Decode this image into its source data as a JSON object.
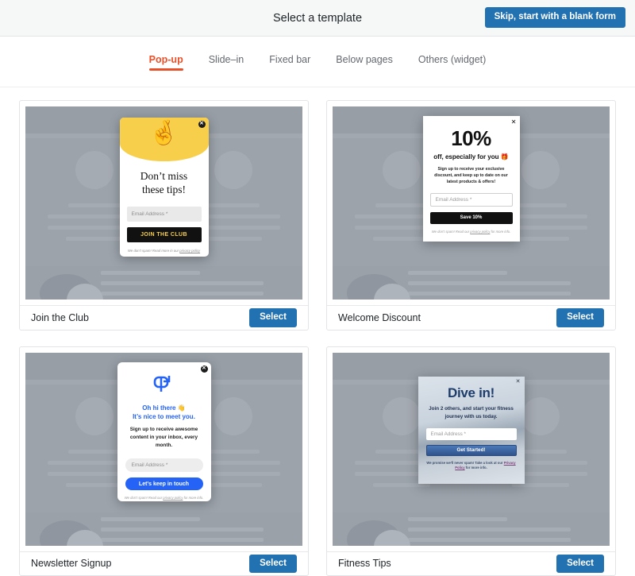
{
  "header": {
    "title": "Select a template",
    "skip_button": "Skip, start with a blank form"
  },
  "tabs": [
    {
      "label": "Pop-up",
      "active": true
    },
    {
      "label": "Slide–in",
      "active": false
    },
    {
      "label": "Fixed bar",
      "active": false
    },
    {
      "label": "Below pages",
      "active": false
    },
    {
      "label": "Others (widget)",
      "active": false
    }
  ],
  "colors": {
    "accent_tab": "#e8502a",
    "primary_button": "#2271b1",
    "template1_yellow": "#f7cf4b",
    "template3_blue": "#2563f6",
    "template4_blue": "#1f3d6b"
  },
  "select_label": "Select",
  "templates": [
    {
      "name": "Join the Club",
      "select_label": "Select",
      "close_icon": "close-icon",
      "popup": {
        "hero_icon": "🤞",
        "title_line1": "Don’t miss",
        "title_line2": "these tips!",
        "input_placeholder": "Email Address *",
        "button_label": "JOIN THE CLUB",
        "footer_text": "We don’t spam! Read more in our ",
        "footer_link": "privacy policy"
      }
    },
    {
      "name": "Welcome Discount",
      "select_label": "Select",
      "close_icon": "close-icon",
      "popup": {
        "headline": "10%",
        "subhead": "off, especially for you 🎁",
        "body": "Sign up to receive your exclusive discount, and keep up to date on our latest products & offers!",
        "input_placeholder": "Email Address *",
        "button_label": "Save 10%",
        "footer_text": "We don’t spam! Read our ",
        "footer_link": "privacy policy",
        "footer_text2": " for more info."
      }
    },
    {
      "name": "Newsletter Signup",
      "select_label": "Select",
      "close_icon": "close-icon",
      "popup": {
        "hero_icon": "mailbox-icon",
        "greeting": "Oh hi there 👋",
        "greeting2": "It’s nice to meet you.",
        "body": "Sign up to receive awesome content in your inbox, every month.",
        "input_placeholder": "Email Address *",
        "button_label": "Let’s keep in touch",
        "footer_text": "We don’t spam! Read our ",
        "footer_link": "privacy policy",
        "footer_text2": " for more info."
      }
    },
    {
      "name": "Fitness Tips",
      "select_label": "Select",
      "close_icon": "close-icon",
      "popup": {
        "headline": "Dive in!",
        "body": "Join 2 others, and start your fitness journey with us today.",
        "input_placeholder": "Email Address *",
        "button_label": "Get Started!",
        "footer_text": "We promise we’ll never spam! Take a look at our ",
        "footer_link": "Privacy Policy",
        "footer_text2": " for more info."
      }
    }
  ]
}
